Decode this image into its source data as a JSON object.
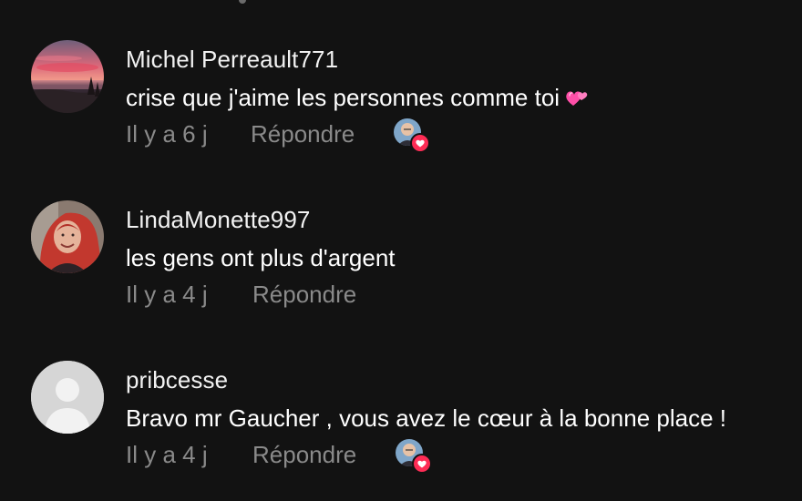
{
  "comments": [
    {
      "username": "Michel Perreault771",
      "text": "crise que j'aime les personnes comme toi",
      "emoji": "two-hearts-emoji",
      "time": "Il y a 6 j",
      "reply_label": "Répondre",
      "liked_by_creator": true
    },
    {
      "username": "LindaMonette997",
      "text": "les gens ont plus d'argent",
      "time": "Il y a 4 j",
      "reply_label": "Répondre",
      "liked_by_creator": false
    },
    {
      "username": "pribcesse",
      "text": "Bravo mr Gaucher , vous avez le cœur à la bonne place !",
      "time": "Il y a 4 j",
      "reply_label": "Répondre",
      "liked_by_creator": true
    }
  ],
  "colors": {
    "background": "#121212",
    "meta_text": "#8a8a8a",
    "heart_badge": "#fe2c55"
  }
}
